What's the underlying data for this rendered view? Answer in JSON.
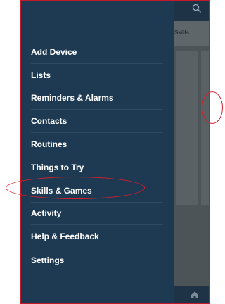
{
  "background": {
    "tab_label": "Skills"
  },
  "menu": {
    "items": [
      {
        "label": "Add Device"
      },
      {
        "label": "Lists"
      },
      {
        "label": "Reminders & Alarms"
      },
      {
        "label": "Contacts"
      },
      {
        "label": "Routines"
      },
      {
        "label": "Things to Try"
      },
      {
        "label": "Skills & Games"
      },
      {
        "label": "Activity"
      },
      {
        "label": "Help & Feedback"
      },
      {
        "label": "Settings"
      }
    ],
    "highlighted_item": "Skills & Games"
  },
  "colors": {
    "drawer_bg": "#1e3a52",
    "annotation_red": "#d51f2c",
    "frame_red": "#c41a2a"
  }
}
